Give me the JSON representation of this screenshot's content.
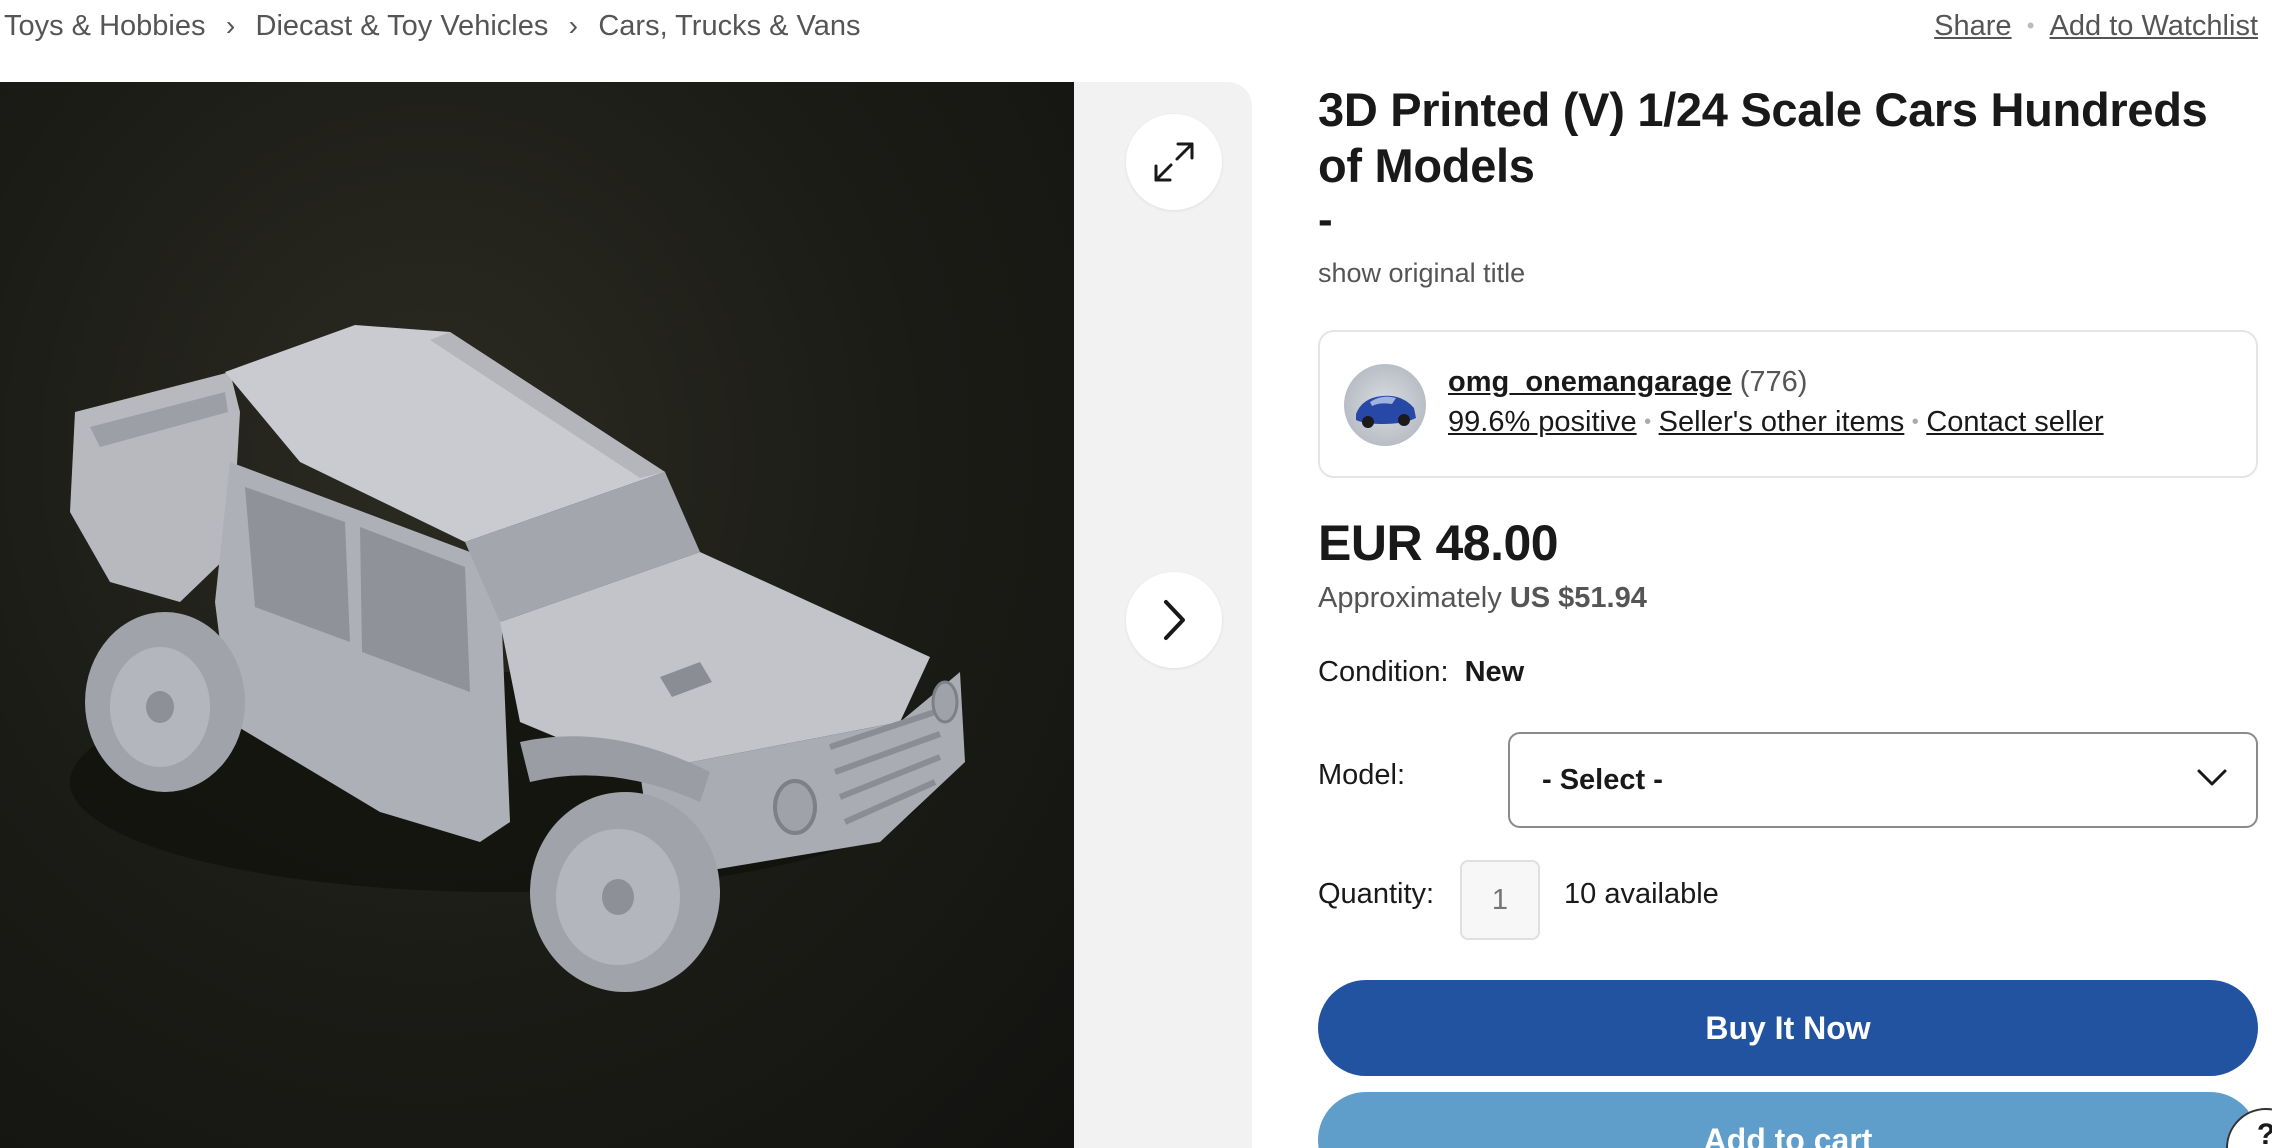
{
  "breadcrumb": {
    "items": [
      "Toys & Hobbies",
      "Diecast & Toy Vehicles",
      "Cars, Trucks & Vans"
    ],
    "separator": "›"
  },
  "top_actions": {
    "share": "Share",
    "watchlist": "Add to Watchlist"
  },
  "gallery": {
    "expand_icon": "expand-icon",
    "next_icon": "chevron-right-icon"
  },
  "listing": {
    "title": "3D Printed (V) 1/24 Scale Cars Hundreds of Models",
    "subtitle": "-",
    "show_original": "show original title"
  },
  "seller": {
    "name": "omg_onemangarage",
    "feedback_count": "(776)",
    "positive": "99.6% positive",
    "other_items": "Seller's other items",
    "contact": "Contact seller"
  },
  "price": {
    "main": "EUR 48.00",
    "approx_label": "Approximately",
    "approx_value": "US $51.94"
  },
  "condition": {
    "label": "Condition:",
    "value": "New"
  },
  "model": {
    "label": "Model:",
    "selected": "- Select -"
  },
  "quantity": {
    "label": "Quantity:",
    "value": "1",
    "available": "10 available"
  },
  "buttons": {
    "buy_now": "Buy It Now",
    "add_to_cart": "Add to cart"
  },
  "help": {
    "glyph": "?"
  },
  "colors": {
    "buy_now": "#2253a0",
    "add_to_cart": "#5f9dca",
    "text": "#191919",
    "muted": "#555555"
  }
}
